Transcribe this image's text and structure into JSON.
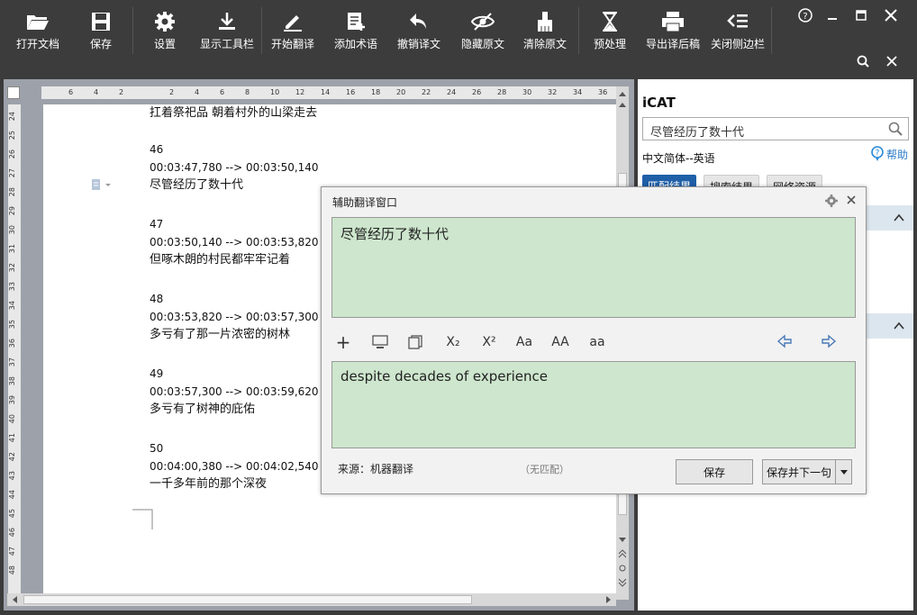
{
  "toolbar": {
    "buttons": [
      {
        "label": "打开文档",
        "icon": "folder-open-icon"
      },
      {
        "label": "保存",
        "icon": "floppy-icon"
      },
      {
        "label": "设置",
        "icon": "gear-icon"
      },
      {
        "label": "显示工具栏",
        "icon": "download-icon"
      },
      {
        "label": "开始翻译",
        "icon": "pencil-icon"
      },
      {
        "label": "添加术语",
        "icon": "note-add-icon"
      },
      {
        "label": "撤销译文",
        "icon": "undo-icon"
      },
      {
        "label": "隐藏原文",
        "icon": "eye-off-icon"
      },
      {
        "label": "清除原文",
        "icon": "brush-icon"
      },
      {
        "label": "预处理",
        "icon": "hourglass-icon"
      },
      {
        "label": "导出译后稿",
        "icon": "printer-icon"
      },
      {
        "label": "关闭侧边栏",
        "icon": "collapse-sidebar-icon"
      }
    ],
    "help_icon": "help-icon",
    "colors": {
      "bg": "#3c3c3c",
      "text": "#ffffff"
    }
  },
  "ruler": {
    "h_ticks": [
      "6",
      "4",
      "2",
      "",
      "2",
      "4",
      "6",
      "8",
      "10",
      "12",
      "14",
      "16",
      "18",
      "20",
      "22",
      "24",
      "26",
      "28",
      "30",
      "32",
      "34",
      "36"
    ],
    "v_ticks": [
      "24",
      "25",
      "26",
      "27",
      "28",
      "29",
      "30",
      "31",
      "32",
      "33",
      "34",
      "35",
      "36",
      "37",
      "38",
      "39",
      "40",
      "41",
      "42",
      "43",
      "44",
      "45",
      "46",
      "47",
      "48"
    ]
  },
  "document": {
    "top_line": "扛着祭祀品 朝着村外的山梁走去",
    "segments": [
      {
        "index": "46",
        "time": "00:03:47,780 --> 00:03:50,140",
        "text": "尽管经历了数十代"
      },
      {
        "index": "47",
        "time": "00:03:50,140 --> 00:03:53,820",
        "text": "但啄木朗的村民都牢牢记着"
      },
      {
        "index": "48",
        "time": "00:03:53,820 --> 00:03:57,300",
        "text": "多亏有了那一片浓密的树林"
      },
      {
        "index": "49",
        "time": "00:03:57,300 --> 00:03:59,620",
        "text": "多亏有了树神的庇佑"
      },
      {
        "index": "50",
        "time": "00:04:00,380 --> 00:04:02,540",
        "text": "一千多年前的那个深夜"
      }
    ]
  },
  "sidebar": {
    "title": "iCAT",
    "search_value": "尽管经历了数十代",
    "lang_pair": "中文简体--英语",
    "help_label": "帮助",
    "tabs": [
      "匹配结果",
      "搜索结果",
      "网络资源"
    ],
    "accent": "#1f5fa8"
  },
  "dialog": {
    "title": "辅助翻译窗口",
    "source_text": "尽管经历了数十代",
    "target_text": "despite decades of experience",
    "tools": [
      "+",
      "X₂",
      "X²",
      "Aa",
      "AA",
      "aa"
    ],
    "source_label": "来源：机器翻译",
    "match_label": "（无匹配）",
    "save_label": "保存",
    "save_next_label": "保存并下一句",
    "box_color": "#cde6cd"
  }
}
